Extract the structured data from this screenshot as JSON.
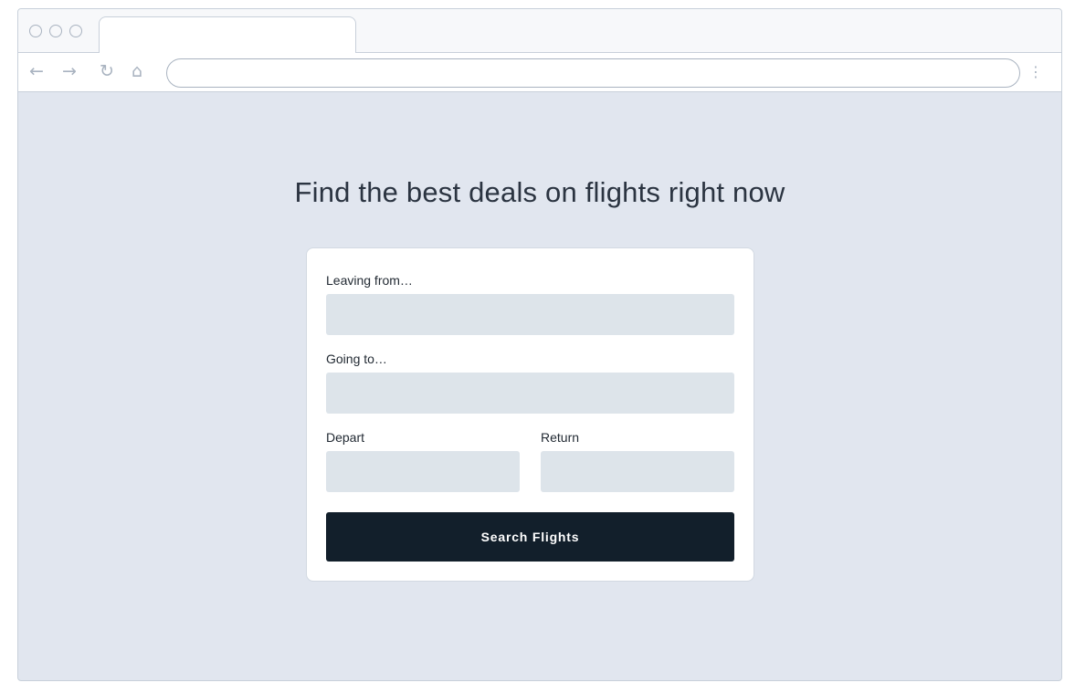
{
  "browser": {
    "tab_title": "",
    "address": "",
    "icons": {
      "back": "arrow-left-icon",
      "forward": "arrow-right-icon",
      "reload": "reload-icon",
      "home": "home-icon",
      "menu": "kebab-menu-icon"
    }
  },
  "page": {
    "headline": "Find the best deals on flights right now",
    "form": {
      "leaving_label": "Leaving from…",
      "leaving_value": "",
      "going_label": "Going to…",
      "going_value": "",
      "depart_label": "Depart",
      "depart_value": "",
      "return_label": "Return",
      "return_value": "",
      "submit_label": "Search Flights"
    }
  },
  "colors": {
    "page_background": "#e1e6ef",
    "input_background": "#dde4ea",
    "button_background": "#121f2b",
    "button_text": "#ffffff",
    "headline_text": "#2b3441"
  }
}
